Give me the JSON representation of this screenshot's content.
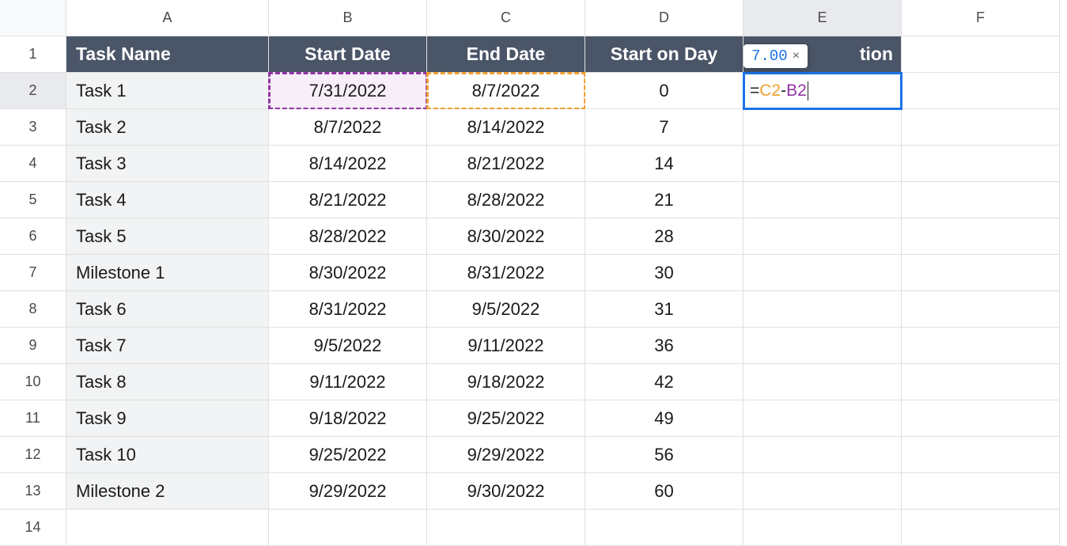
{
  "columns": [
    "A",
    "B",
    "C",
    "D",
    "E",
    "F"
  ],
  "row_numbers": [
    "1",
    "2",
    "3",
    "4",
    "5",
    "6",
    "7",
    "8",
    "9",
    "10",
    "11",
    "12",
    "13",
    "14"
  ],
  "headers": {
    "A": "Task Name",
    "B": "Start Date",
    "C": "End Date",
    "D": "Start on Day",
    "E_full": "Duration",
    "E_visible": "tion"
  },
  "rows": [
    {
      "task": "Task 1",
      "start": "7/31/2022",
      "end": "8/7/2022",
      "startday": "0"
    },
    {
      "task": "Task 2",
      "start": "8/7/2022",
      "end": "8/14/2022",
      "startday": "7"
    },
    {
      "task": "Task 3",
      "start": "8/14/2022",
      "end": "8/21/2022",
      "startday": "14"
    },
    {
      "task": "Task 4",
      "start": "8/21/2022",
      "end": "8/28/2022",
      "startday": "21"
    },
    {
      "task": "Task 5",
      "start": "8/28/2022",
      "end": "8/30/2022",
      "startday": "28"
    },
    {
      "task": "Milestone 1",
      "start": "8/30/2022",
      "end": "8/31/2022",
      "startday": "30"
    },
    {
      "task": "Task 6",
      "start": "8/31/2022",
      "end": "9/5/2022",
      "startday": "31"
    },
    {
      "task": "Task 7",
      "start": "9/5/2022",
      "end": "9/11/2022",
      "startday": "36"
    },
    {
      "task": "Task 8",
      "start": "9/11/2022",
      "end": "9/18/2022",
      "startday": "42"
    },
    {
      "task": "Task 9",
      "start": "9/18/2022",
      "end": "9/25/2022",
      "startday": "49"
    },
    {
      "task": "Task 10",
      "start": "9/25/2022",
      "end": "9/29/2022",
      "startday": "56"
    },
    {
      "task": "Milestone 2",
      "start": "9/29/2022",
      "end": "9/30/2022",
      "startday": "60"
    }
  ],
  "active_cell": {
    "address": "E2",
    "formula_parts": {
      "eq": "=",
      "ref_c": "C2",
      "op": "-",
      "ref_b": "B2"
    },
    "tooltip_value": "7.00",
    "tooltip_close": "×"
  }
}
